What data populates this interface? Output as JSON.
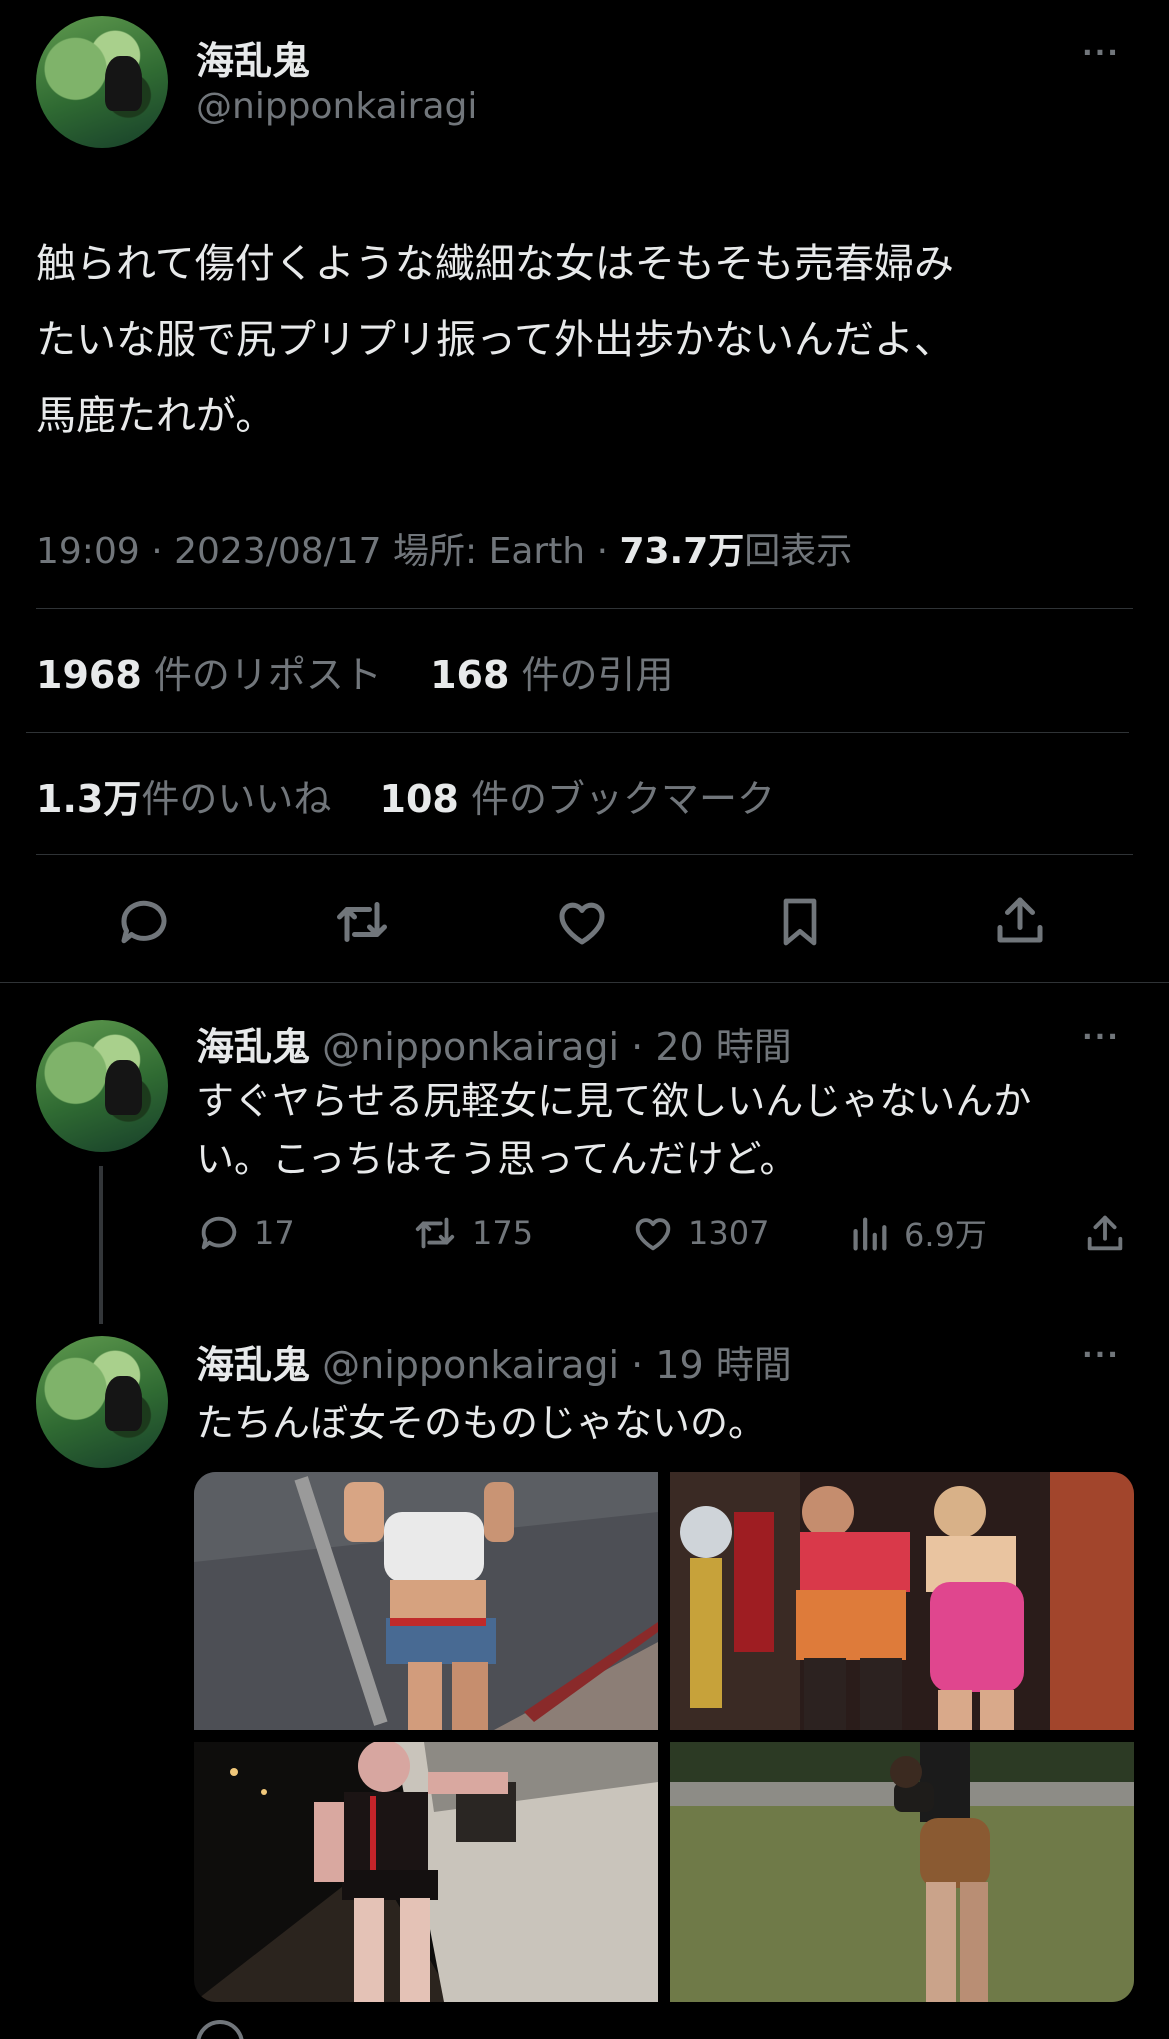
{
  "main_tweet": {
    "display_name": "海乱鬼",
    "handle": "@nipponkairagi",
    "more": "···",
    "text_line1": "触られて傷付くような繊細な女はそもそも売春婦み",
    "text_line2": "たいな服で尻プリプリ振って外出歩かないんだよ、",
    "text_line3": "馬鹿たれが。",
    "timestamp": "19:09 · 2023/08/17 場所: Earth · ",
    "views_count": "73.7万",
    "views_label": "回表示",
    "reposts_count": "1968",
    "reposts_label": "件のリポスト",
    "quotes_count": "168",
    "quotes_label": "件の引用",
    "likes_count": "1.3万",
    "likes_label": "件のいいね",
    "bookmarks_count": "108",
    "bookmarks_label": "件のブックマーク"
  },
  "reply1": {
    "display_name": "海乱鬼",
    "handle_time": "@nipponkairagi · 20 時間",
    "more": "···",
    "text_line1": "すぐヤらせる尻軽女に見て欲しいんじゃないんか",
    "text_line2": "い。こっちはそう思ってんだけど。",
    "replies": "17",
    "reposts": "175",
    "likes": "1307",
    "views": "6.9万"
  },
  "reply2": {
    "display_name": "海乱鬼",
    "handle_time": "@nipponkairagi · 19 時間",
    "more": "···",
    "text": "たちんぼ女そのものじゃないの。"
  },
  "colors": {
    "background": "#000000",
    "text": "#e7e9ea",
    "muted": "#71767b",
    "divider": "#2f3336"
  },
  "icons": [
    "reply-icon",
    "repost-icon",
    "like-icon",
    "bookmark-icon",
    "share-icon",
    "views-icon",
    "more-icon"
  ]
}
